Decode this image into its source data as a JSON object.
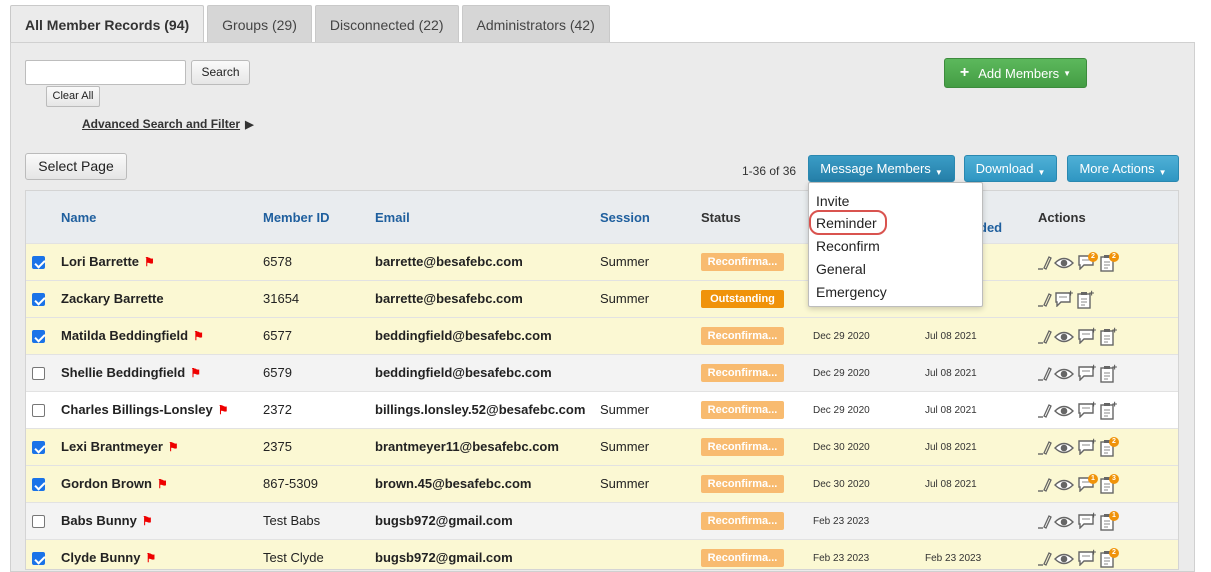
{
  "tabs": [
    {
      "label": "All Member Records (94)"
    },
    {
      "label": "Groups (29)"
    },
    {
      "label": "Disconnected (22)"
    },
    {
      "label": "Administrators (42)"
    }
  ],
  "toolbar": {
    "search_value": "",
    "search_label": "Search",
    "clear_label": "Clear All",
    "advanced_label": "Advanced Search and Filter",
    "add_members_label": "Add Members",
    "select_page_label": "Select Page",
    "count_text": "1-36 of 36",
    "message_members_label": "Message Members",
    "download_label": "Download",
    "more_actions_label": "More Actions",
    "accent_green": "#5cb85c",
    "accent_blue": "#3aa3cf"
  },
  "dropdown": {
    "items": [
      "Invite",
      "Reminder",
      "Reconfirm",
      "General",
      "Emergency"
    ],
    "highlighted": "Reminder"
  },
  "columns": [
    "Name",
    "Member ID",
    "Email",
    "Session",
    "Status",
    "ded",
    "Actions"
  ],
  "rows": [
    {
      "checked": true,
      "name": "Lori Barrette",
      "flag": true,
      "id": "6578",
      "email": "barrette@besafebc.com",
      "session": "Summer",
      "status": "Reconfirma...",
      "status_type": "reconfirm",
      "date1": "",
      "date2": "",
      "badges": [
        "2",
        "2"
      ]
    },
    {
      "checked": true,
      "name": "Zackary Barrette",
      "flag": false,
      "id": "31654",
      "email": "barrette@besafebc.com",
      "session": "Summer",
      "status": "Outstanding",
      "status_type": "outstanding",
      "date1": "",
      "date2": "",
      "badges": [
        "",
        ""
      ]
    },
    {
      "checked": true,
      "name": "Matilda Beddingfield",
      "flag": true,
      "id": "6577",
      "email": "beddingfield@besafebc.com",
      "session": "",
      "status": "Reconfirma...",
      "status_type": "reconfirm",
      "date1": "Dec 29 2020",
      "date2": "Jul 08 2021",
      "badges": [
        "",
        ""
      ]
    },
    {
      "checked": false,
      "name": "Shellie Beddingfield",
      "flag": true,
      "id": "6579",
      "email": "beddingfield@besafebc.com",
      "session": "",
      "status": "Reconfirma...",
      "status_type": "reconfirm",
      "date1": "Dec 29 2020",
      "date2": "Jul 08 2021",
      "badges": [
        "",
        ""
      ]
    },
    {
      "checked": false,
      "name": "Charles Billings-Lonsley",
      "flag": true,
      "id": "2372",
      "email": "billings.lonsley.52@besafebc.com",
      "session": "Summer",
      "status": "Reconfirma...",
      "status_type": "reconfirm",
      "date1": "Dec 29 2020",
      "date2": "Jul 08 2021",
      "badges": [
        "",
        ""
      ]
    },
    {
      "checked": true,
      "name": "Lexi Brantmeyer",
      "flag": true,
      "id": "2375",
      "email": "brantmeyer11@besafebc.com",
      "session": "Summer",
      "status": "Reconfirma...",
      "status_type": "reconfirm",
      "date1": "Dec 30 2020",
      "date2": "Jul 08 2021",
      "badges": [
        "",
        "2"
      ]
    },
    {
      "checked": true,
      "name": "Gordon Brown",
      "flag": true,
      "id": "867-5309",
      "email": "brown.45@besafebc.com",
      "session": "Summer",
      "status": "Reconfirma...",
      "status_type": "reconfirm",
      "date1": "Dec 30 2020",
      "date2": "Jul 08 2021",
      "badges": [
        "1",
        "3"
      ]
    },
    {
      "checked": false,
      "name": "Babs Bunny",
      "flag": true,
      "id": "Test Babs",
      "email": "bugsb972@gmail.com",
      "session": "",
      "status": "Reconfirma...",
      "status_type": "reconfirm",
      "date1": "Feb 23 2023",
      "date2": "",
      "badges": [
        "",
        "1"
      ]
    },
    {
      "checked": true,
      "name": "Clyde Bunny",
      "flag": true,
      "id": "Test Clyde",
      "email": "bugsb972@gmail.com",
      "session": "",
      "status": "Reconfirma...",
      "status_type": "reconfirm",
      "date1": "Feb 23 2023",
      "date2": "Feb 23 2023",
      "badges": [
        "",
        "2"
      ]
    }
  ]
}
